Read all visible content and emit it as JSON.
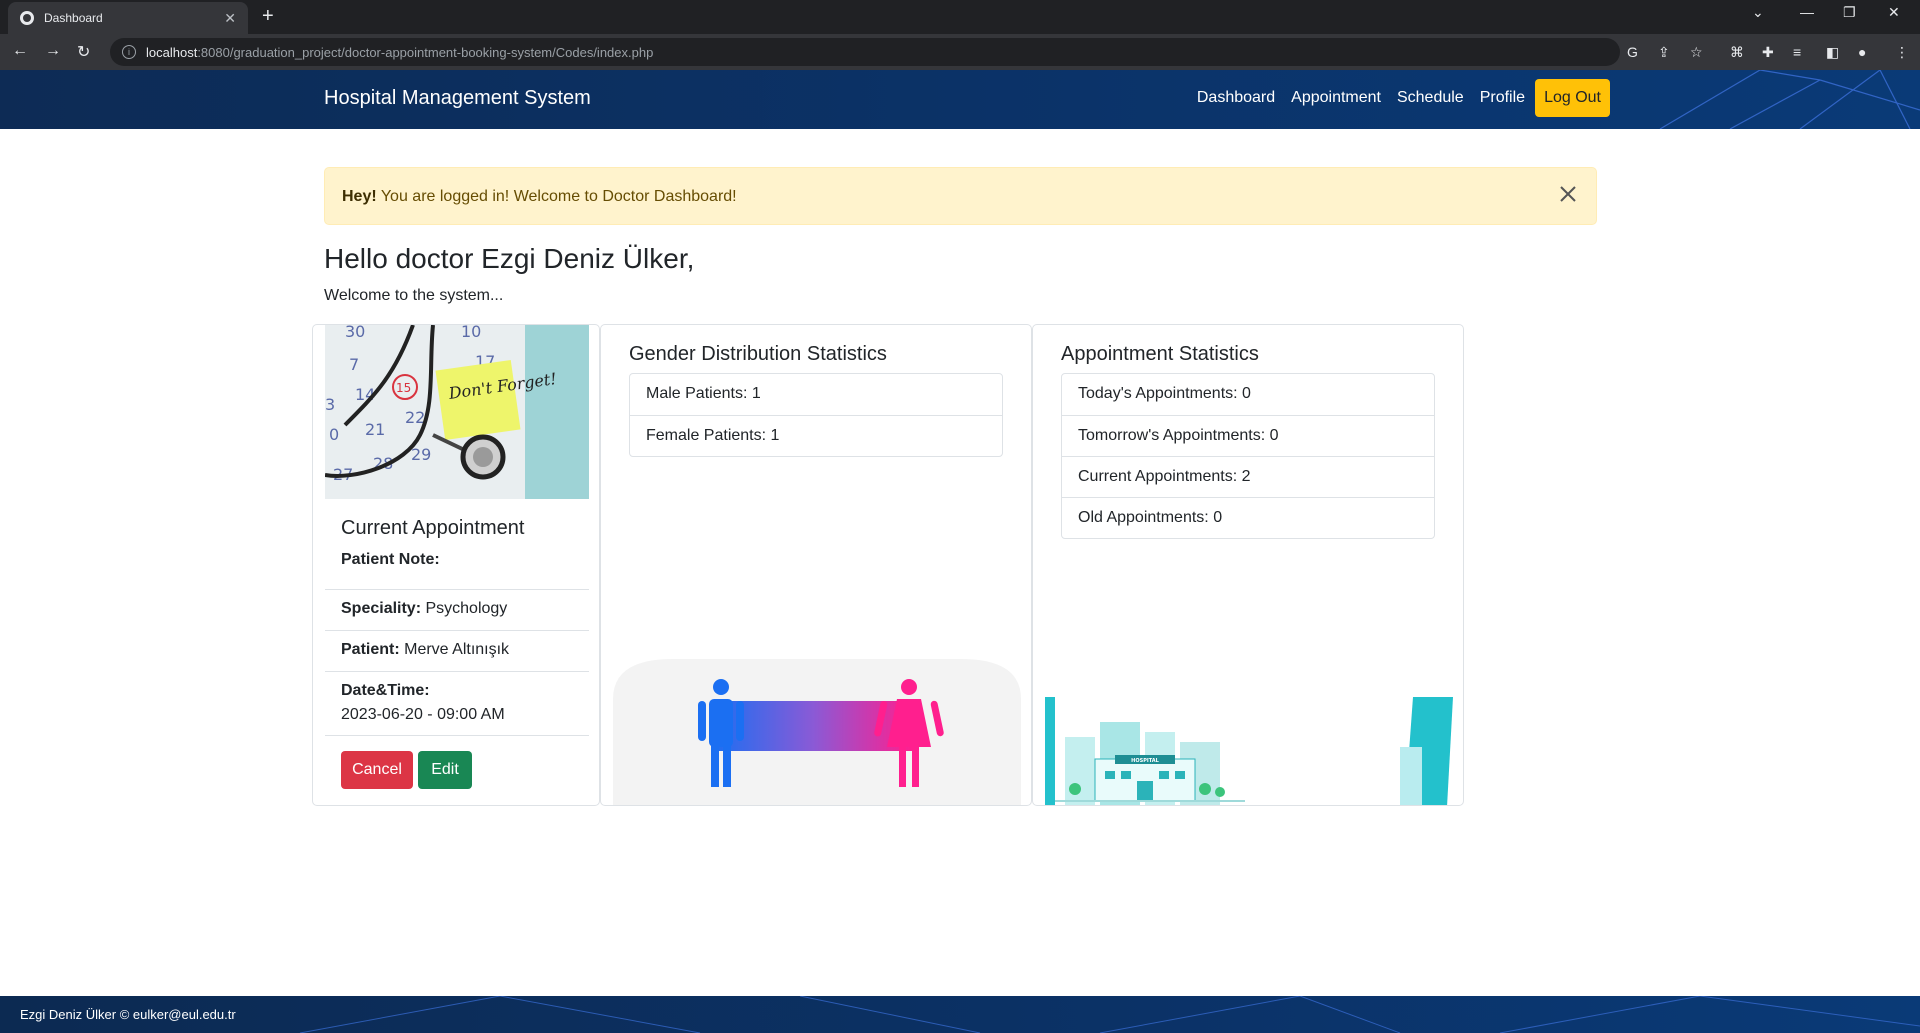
{
  "browser": {
    "tab_title": "Dashboard",
    "url_host": "localhost",
    "url_rest": ":8080/graduation_project/doctor-appointment-booking-system/Codes/index.php"
  },
  "nav": {
    "brand": "Hospital Management System",
    "links": [
      "Dashboard",
      "Appointment",
      "Schedule",
      "Profile"
    ],
    "logout": "Log Out"
  },
  "alert": {
    "strong": "Hey!",
    "text": " You are logged in! Welcome to Doctor Dashboard!"
  },
  "greeting": {
    "title": "Hello doctor Ezgi Deniz Ülker,",
    "subtitle": "Welcome to the system..."
  },
  "current_appointment": {
    "title": "Current Appointment",
    "note_label": "Patient Note:",
    "speciality_label": "Speciality:",
    "speciality": "Psychology",
    "patient_label": "Patient:",
    "patient": "Merve Altınışık",
    "datetime_label": "Date&Time:",
    "datetime": "2023-06-20 - 09:00 AM",
    "photo_note": "Don't Forget!",
    "cancel": "Cancel",
    "edit": "Edit"
  },
  "gender_stats": {
    "title": "Gender Distribution Statistics",
    "rows": [
      "Male Patients: 1",
      "Female Patients: 1"
    ]
  },
  "appointment_stats": {
    "title": "Appointment Statistics",
    "rows": [
      "Today's Appointments: 0",
      "Tomorrow's Appointments: 0",
      "Current Appointments: 2",
      "Old Appointments: 0"
    ],
    "hospital_sign": "HOSPITAL"
  },
  "footer": {
    "text": "Ezgi Deniz Ülker © eulker@eul.edu.tr"
  },
  "colors": {
    "navbar": "#0b3267",
    "logout_bg": "#ffc107",
    "alert_bg": "#fff3cd",
    "cancel": "#dc3545",
    "edit": "#198754"
  }
}
